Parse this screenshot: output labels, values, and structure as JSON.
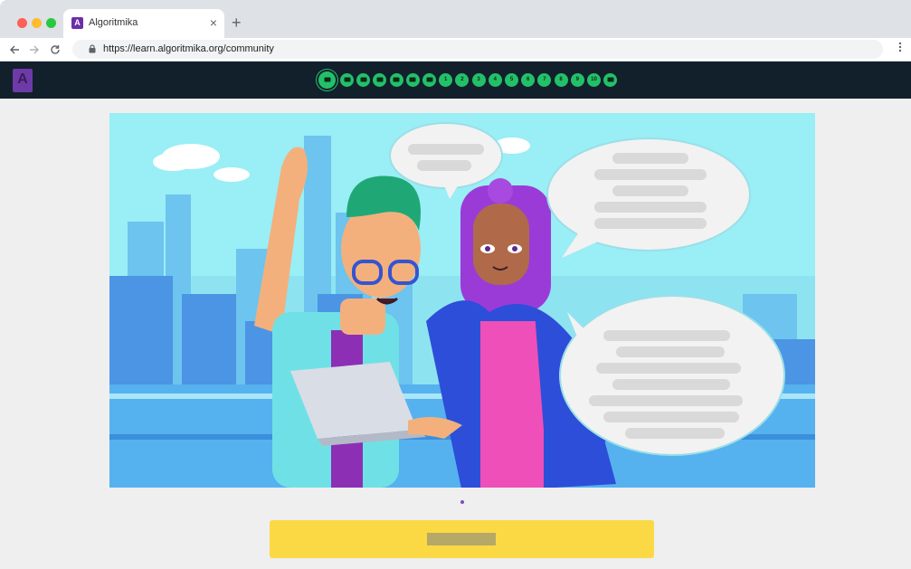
{
  "browser": {
    "tab_title": "Algoritmika",
    "tab_favicon": "A",
    "tab_close": "×",
    "new_tab": "+",
    "url": "https://learn.algoritmika.org/community",
    "back_icon": "arrow-left-icon",
    "forward_icon": "arrow-right-icon",
    "reload_icon": "reload-icon",
    "menu_icon": "kebab-menu-icon"
  },
  "site": {
    "logo_letter": "A",
    "brand_color": "#6e3aa7",
    "step_color": "#23c06a",
    "steps": [
      {
        "label": "",
        "icon": "video-icon",
        "active": true
      },
      {
        "label": "",
        "icon": "video-icon",
        "active": false
      },
      {
        "label": "",
        "icon": "video-icon",
        "active": false
      },
      {
        "label": "",
        "icon": "document-icon",
        "active": false
      },
      {
        "label": "",
        "icon": "video-icon",
        "active": false
      },
      {
        "label": "",
        "icon": "video-icon",
        "active": false
      },
      {
        "label": "",
        "icon": "video-icon",
        "active": false
      },
      {
        "label": "1",
        "icon": "",
        "active": false
      },
      {
        "label": "2",
        "icon": "",
        "active": false
      },
      {
        "label": "3",
        "icon": "",
        "active": false
      },
      {
        "label": "4",
        "icon": "",
        "active": false
      },
      {
        "label": "5",
        "icon": "",
        "active": false
      },
      {
        "label": "6",
        "icon": "",
        "active": false
      },
      {
        "label": "7",
        "icon": "",
        "active": false
      },
      {
        "label": "8",
        "icon": "",
        "active": false
      },
      {
        "label": "9",
        "icon": "",
        "active": false
      },
      {
        "label": "10",
        "icon": "",
        "active": false
      },
      {
        "label": "",
        "icon": "video-icon",
        "active": false
      }
    ]
  },
  "slide": {
    "illustration": "two-characters-city-illustration",
    "speech_bubbles": 3,
    "pager_current": 1,
    "pager_total": 1
  },
  "cta": {
    "label": "",
    "color": "#fad944"
  }
}
